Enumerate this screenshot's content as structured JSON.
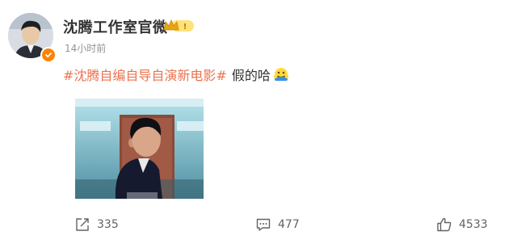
{
  "post": {
    "author": "沈腾工作室官微",
    "time": "14小时前",
    "hashtag": "#沈腾自编自导自演新电影#",
    "text": "假的哈",
    "badge_level": "!"
  },
  "footer": {
    "share_count": "335",
    "comment_count": "477",
    "like_count": "4533"
  },
  "colors": {
    "hashtag": "#eb7350",
    "verified": "#ff8200",
    "muted": "#939393"
  }
}
